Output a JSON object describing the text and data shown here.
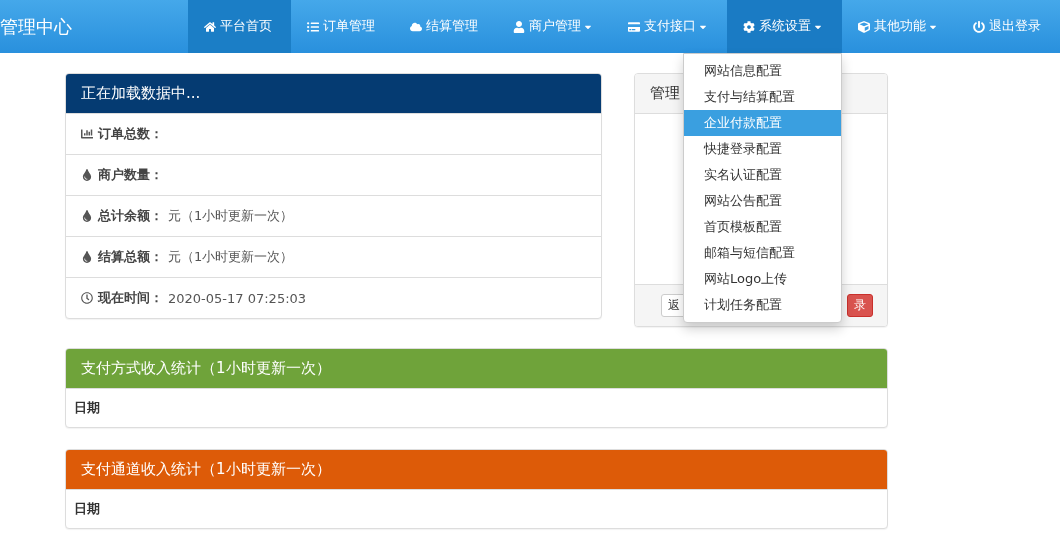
{
  "navbar": {
    "brand": "管理中心",
    "items": [
      {
        "label": "平台首页",
        "selected": true,
        "has_menu": false,
        "expanded": false
      },
      {
        "label": "订单管理",
        "selected": false,
        "has_menu": false,
        "expanded": false
      },
      {
        "label": "结算管理",
        "selected": false,
        "has_menu": false,
        "expanded": false
      },
      {
        "label": "商户管理",
        "selected": false,
        "has_menu": true,
        "expanded": false
      },
      {
        "label": "支付接口",
        "selected": false,
        "has_menu": true,
        "expanded": false
      },
      {
        "label": "系统设置",
        "selected": false,
        "has_menu": true,
        "expanded": true,
        "menu": [
          {
            "label": "网站信息配置",
            "selected": false
          },
          {
            "label": "支付与结算配置",
            "selected": false
          },
          {
            "label": "企业付款配置",
            "selected": true
          },
          {
            "label": "快捷登录配置",
            "selected": false
          },
          {
            "label": "实名认证配置",
            "selected": false
          },
          {
            "label": "网站公告配置",
            "selected": false
          },
          {
            "label": "首页模板配置",
            "selected": false
          },
          {
            "label": "邮箱与短信配置",
            "selected": false
          },
          {
            "label": "网站Logo上传",
            "selected": false
          },
          {
            "label": "计划任务配置",
            "selected": false
          }
        ]
      },
      {
        "label": "其他功能",
        "selected": false,
        "has_menu": true,
        "expanded": false
      },
      {
        "label": "退出登录",
        "selected": false,
        "has_menu": false,
        "expanded": false
      }
    ]
  },
  "stats_panel": {
    "title": "正在加载数据中...",
    "rows": [
      {
        "label": "订单总数：",
        "value": ""
      },
      {
        "label": "商户数量：",
        "value": ""
      },
      {
        "label": "总计余额：",
        "value": "元（1小时更新一次）"
      },
      {
        "label": "结算总额：",
        "value": "元（1小时更新一次）"
      },
      {
        "label": "现在时间：",
        "value": "2020-05-17 07:25:03"
      }
    ]
  },
  "admin_panel": {
    "title": "管理",
    "buttons": [
      {
        "label": "返",
        "kind": "default"
      },
      {
        "label": "录",
        "kind": "danger"
      }
    ]
  },
  "income_panels": [
    {
      "title": "支付方式收入统计（1小时更新一次）",
      "color": "#6fa33a",
      "column": "日期"
    },
    {
      "title": "支付通道收入统计（1小时更新一次）",
      "color": "#dd5b08",
      "column": "日期"
    }
  ]
}
